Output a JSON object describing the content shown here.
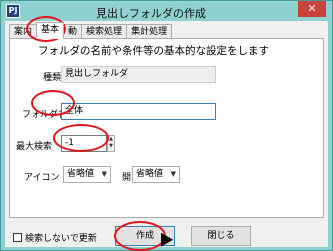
{
  "window": {
    "title": "見出しフォルダの作成",
    "app_icon": "PJ",
    "close_glyph": "✕"
  },
  "tabs": [
    {
      "label": "案内",
      "active": false
    },
    {
      "label": "基本",
      "active": true
    },
    {
      "label": "動",
      "active": false
    },
    {
      "label": "検索処理",
      "active": false
    },
    {
      "label": "集計処理",
      "active": false
    }
  ],
  "panel": {
    "header": "フォルダの名前や条件等の基本的な設定をします",
    "type_label": "種類",
    "type_value": "見出しフォルダ",
    "folder_label": "フォルダ名",
    "folder_value": "全体",
    "max_label": "最大検索",
    "max_value": "-1",
    "icon_label": "アイコン 閉",
    "icon_closed_value": "省略値",
    "icon_open_label": "開",
    "icon_open_value": "省略値"
  },
  "footer": {
    "checkbox_label": "検索しないで更新",
    "create_label": "作成",
    "close_label": "閉じる"
  },
  "colors": {
    "annotation": "#e0161b",
    "frame": "#8fd1d0",
    "close_button": "#c7423a"
  }
}
